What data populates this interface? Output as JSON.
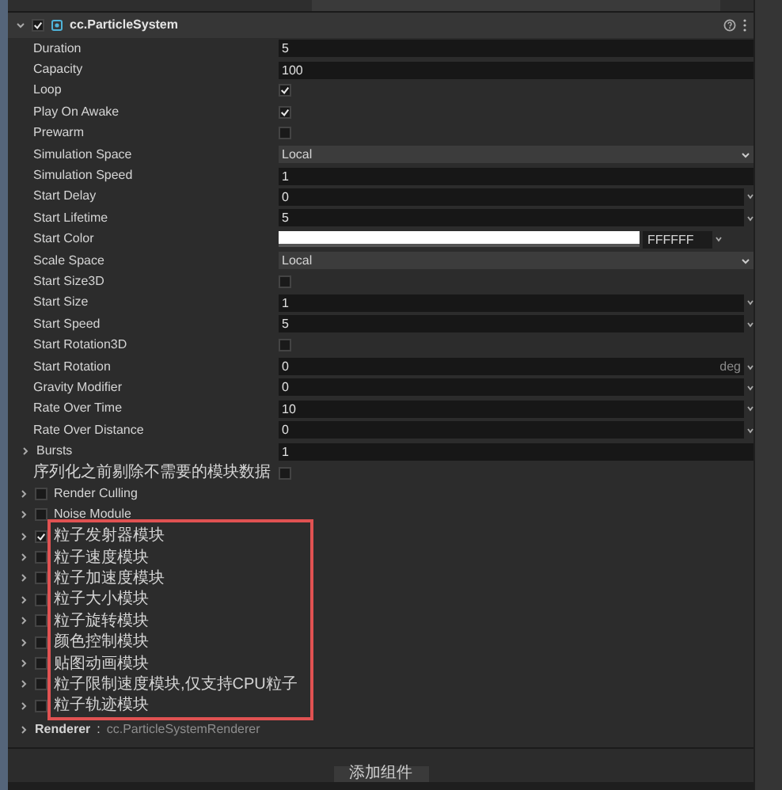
{
  "header": {
    "title": "cc.ParticleSystem",
    "expanded": true,
    "enabled": true
  },
  "properties": [
    {
      "kind": "number",
      "label": "Duration",
      "value": "5"
    },
    {
      "kind": "number",
      "label": "Capacity",
      "value": "100"
    },
    {
      "kind": "checkbox",
      "label": "Loop",
      "checked": true
    },
    {
      "kind": "checkbox",
      "label": "Play On Awake",
      "checked": true
    },
    {
      "kind": "checkbox",
      "label": "Prewarm",
      "checked": false
    },
    {
      "kind": "select",
      "label": "Simulation Space",
      "value": "Local"
    },
    {
      "kind": "number",
      "label": "Simulation Speed",
      "value": "1"
    },
    {
      "kind": "curve",
      "label": "Start Delay",
      "value": "0"
    },
    {
      "kind": "curve",
      "label": "Start Lifetime",
      "value": "5"
    },
    {
      "kind": "color",
      "label": "Start Color",
      "color": "#ffffff",
      "hex": "FFFFFF"
    },
    {
      "kind": "select",
      "label": "Scale Space",
      "value": "Local"
    },
    {
      "kind": "checkbox",
      "label": "Start Size3D",
      "checked": false
    },
    {
      "kind": "curve",
      "label": "Start Size",
      "value": "1"
    },
    {
      "kind": "curve",
      "label": "Start Speed",
      "value": "5"
    },
    {
      "kind": "checkbox",
      "label": "Start Rotation3D",
      "checked": false
    },
    {
      "kind": "curve",
      "label": "Start Rotation",
      "value": "0",
      "unit": "deg"
    },
    {
      "kind": "curve",
      "label": "Gravity Modifier",
      "value": "0"
    },
    {
      "kind": "curve",
      "label": "Rate Over Time",
      "value": "10"
    },
    {
      "kind": "curve",
      "label": "Rate Over Distance",
      "value": "0"
    },
    {
      "kind": "foldout",
      "label": "Bursts",
      "value": "1",
      "expanded": false
    },
    {
      "kind": "checkbox",
      "label": "序列化之前剔除不需要的模块数据",
      "checked": false
    }
  ],
  "modules": [
    {
      "label": "Render Culling",
      "enabled": false,
      "expanded": false
    },
    {
      "label": "Noise Module",
      "enabled": false,
      "expanded": false
    }
  ],
  "highlight_frame": {
    "modules": [
      {
        "label": "粒子发射器模块",
        "enabled": true,
        "expanded": false
      },
      {
        "label": "粒子速度模块",
        "enabled": false,
        "expanded": false
      },
      {
        "label": "粒子加速度模块",
        "enabled": false,
        "expanded": false
      },
      {
        "label": "粒子大小模块",
        "enabled": false,
        "expanded": false
      },
      {
        "label": "粒子旋转模块",
        "enabled": false,
        "expanded": false
      },
      {
        "label": "颜色控制模块",
        "enabled": false,
        "expanded": false
      },
      {
        "label": "贴图动画模块",
        "enabled": false,
        "expanded": false
      },
      {
        "label": "粒子限制速度模块,仅支持CPU粒子",
        "enabled": false,
        "expanded": false
      },
      {
        "label": "粒子轨迹模块",
        "enabled": false,
        "expanded": false
      }
    ]
  },
  "renderer": {
    "label": "Renderer",
    "separator": ":",
    "type": "cc.ParticleSystemRenderer",
    "expanded": false
  },
  "add_button": "添加组件"
}
